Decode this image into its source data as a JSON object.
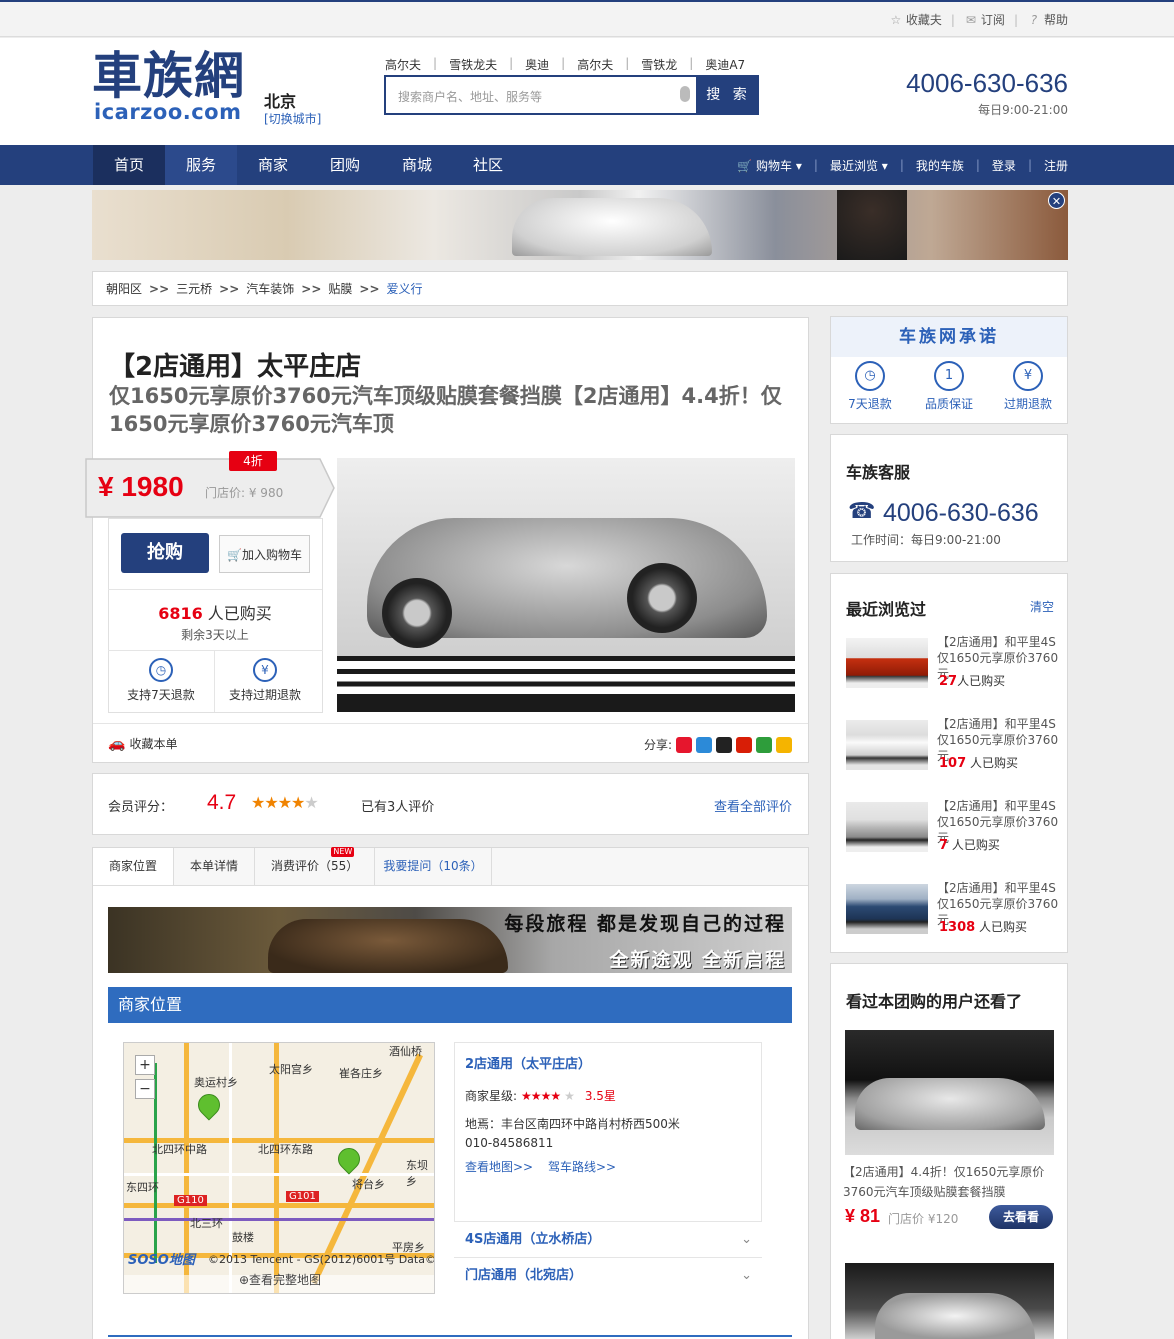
{
  "topbar": {
    "favorites": "收藏夫",
    "subscribe": "订阅",
    "help": "帮助"
  },
  "header": {
    "logo_cn": "車族網",
    "logo_en": "icarzoo.com",
    "city": "北京",
    "switch_city": "[切换城市]",
    "hotwords": [
      "高尔夫",
      "雪铁龙夫",
      "奥迪",
      "高尔夫",
      "雪铁龙",
      "奥迪A7"
    ],
    "search_placeholder": "搜索商户名、地址、服务等",
    "search_button": "搜 索",
    "phone": "4006-630-636",
    "hours": "每日9:00-21:00"
  },
  "nav": {
    "items": [
      "首页",
      "服务",
      "商家",
      "团购",
      "商城",
      "社区"
    ],
    "right": [
      "购物车",
      "最近浏览",
      "我的车族",
      "登录",
      "注册"
    ]
  },
  "breadcrumb": [
    "朝阳区",
    "三元桥",
    "汽车装饰",
    "贴膜",
    "爱义行"
  ],
  "deal": {
    "title": "【2店通用】太平庄店",
    "subtitle": "仅1650元享原价3760元汽车顶级贴膜套餐挡膜【2店通用】4.4折！仅1650元享原价3760元汽车顶",
    "price": "¥ 1980",
    "orig_price": "门店价: ¥ 980",
    "discount": "4折",
    "buy": "抢购",
    "add_cart": "加入购物车",
    "buyers_count": "6816",
    "buyers_label": " 人已购买",
    "remaining": "剩余3天以上",
    "guarantee1": "支持7天退款",
    "guarantee2": "支持过期退款",
    "favorite": "收藏本单",
    "share": "分享:"
  },
  "rating": {
    "label": "会员评分：",
    "score": "4.7",
    "stars": 4.5,
    "count": "已有3人评价",
    "view_all": "查看全部评价"
  },
  "tabs": [
    "商家位置",
    "本单详情",
    "消费评价（55）",
    "我要提问（10条）"
  ],
  "tab_new_badge": "NEW",
  "ad": {
    "line1": "每段旅程 都是发现自己的过程",
    "line2": "全新途观 全新启程"
  },
  "location": {
    "header": "商家位置",
    "map_labels": [
      "奥运村乡",
      "太阳宫乡",
      "北四环中路",
      "北四环东路",
      "酒仙桥",
      "崔各庄乡",
      "将台乡",
      "北三环",
      "东四环",
      "G110",
      "G101",
      "鼓楼",
      "平房乡",
      "东坝乡"
    ],
    "map_copyright": "©2013 Tencent - GS(2012)6001号 Data©",
    "map_logo": "SOSO地图",
    "map_full": "查看完整地图",
    "shop_name": "2店通用（太平庄店）",
    "shop_star_label": "商家星级:",
    "shop_star_value": "3.5星",
    "shop_address": "地焉：丰台区南四环中路肖村桥西500米",
    "shop_phone": "010-84586811",
    "view_map": "查看地图>>",
    "drive_route": "驾车路线>>",
    "other_shops": [
      "4S店通用（立水桥店）",
      "门店通用（北宛店）"
    ]
  },
  "promise": {
    "title": "车族网承诺",
    "items": [
      "7天退款",
      "品质保证",
      "过期退款"
    ]
  },
  "service": {
    "title": "车族客服",
    "phone": "4006-630-636",
    "hours": "工作时间：每日9:00-21:00"
  },
  "recent": {
    "title": "最近浏览过",
    "clear": "清空",
    "items": [
      {
        "text": "【2店通用】和平里4S 仅1650元享原价3760元",
        "count": "27",
        "suffix": "人已购买"
      },
      {
        "text": "【2店通用】和平里4S 仅1650元享原价3760元",
        "count": "107",
        "suffix": " 人已购买"
      },
      {
        "text": "【2店通用】和平里4S 仅1650元享原价3760元",
        "count": "7",
        "suffix": " 人已购买"
      },
      {
        "text": "【2店通用】和平里4S 仅1650元享原价3760元",
        "count": "1308",
        "suffix": " 人已购买"
      }
    ]
  },
  "also": {
    "title": "看过本团购的用户还看了",
    "item_text": "【2店通用】4.4折！仅1650元享原价3760元汽车顶级贴膜套餐挡膜",
    "item_price": "¥ 81",
    "item_orig": "门店价 ¥120",
    "go_button": "去看看"
  },
  "colors": {
    "brand": "#24407d",
    "accent_red": "#e60012",
    "link_blue": "#2c61b8",
    "star_orange": "#f08300"
  }
}
